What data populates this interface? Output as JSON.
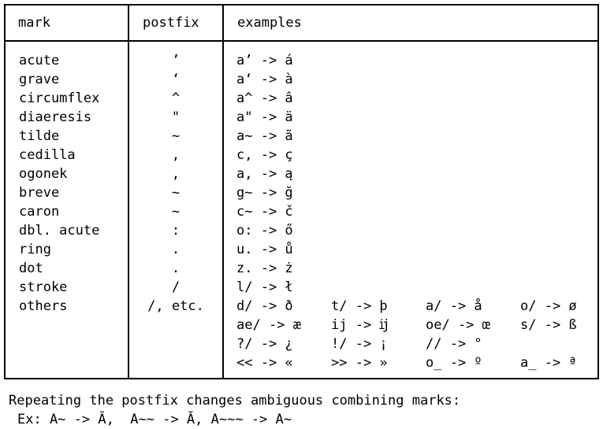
{
  "headers": {
    "mark": "mark",
    "postfix": "postfix",
    "examples": "examples"
  },
  "rows": [
    {
      "mark": "acute",
      "postfix": "’",
      "examples": [
        "a’ -> á"
      ]
    },
    {
      "mark": "grave",
      "postfix": "‘",
      "examples": [
        "a‘ -> à"
      ]
    },
    {
      "mark": "circumflex",
      "postfix": "^",
      "examples": [
        "a^ -> â"
      ]
    },
    {
      "mark": "diaeresis",
      "postfix": "\"",
      "examples": [
        "a\" -> ä"
      ]
    },
    {
      "mark": "tilde",
      "postfix": "~",
      "examples": [
        "a~ -> ã"
      ]
    },
    {
      "mark": "cedilla",
      "postfix": ",",
      "examples": [
        "c, -> ç"
      ]
    },
    {
      "mark": "ogonek",
      "postfix": ",",
      "examples": [
        "a, -> ą"
      ]
    },
    {
      "mark": "breve",
      "postfix": "~",
      "examples": [
        "g~ -> ğ"
      ]
    },
    {
      "mark": "caron",
      "postfix": "~",
      "examples": [
        "c~ -> č"
      ]
    },
    {
      "mark": "dbl. acute",
      "postfix": ":",
      "examples": [
        "o: -> ő"
      ]
    },
    {
      "mark": "ring",
      "postfix": ".",
      "examples": [
        "u. -> ů"
      ]
    },
    {
      "mark": "dot",
      "postfix": ".",
      "examples": [
        "z. -> ż"
      ]
    },
    {
      "mark": "stroke",
      "postfix": "/",
      "examples": [
        "l/ -> ł"
      ]
    },
    {
      "mark": "others",
      "postfix": "/, etc.",
      "examples": [
        "d/ -> ð",
        "t/ -> þ",
        "a/ -> å",
        "o/ -> ø"
      ]
    },
    {
      "mark": "",
      "postfix": "",
      "examples": [
        "ae/ -> æ",
        "ij -> ĳ",
        "oe/ -> œ",
        "s/ -> ß"
      ]
    },
    {
      "mark": "",
      "postfix": "",
      "examples": [
        "?/ -> ¿",
        "!/ -> ¡",
        "// -> °",
        ""
      ]
    },
    {
      "mark": "",
      "postfix": "",
      "examples": [
        "<< -> «",
        ">> -> »",
        "o_ -> º",
        "a_ -> ª"
      ]
    }
  ],
  "footer": {
    "note": "Repeating the postfix changes ambiguous combining marks:",
    "example": "Ex: A~ -> Ã,  A~~ -> Ă, A~~~ -> A~"
  }
}
